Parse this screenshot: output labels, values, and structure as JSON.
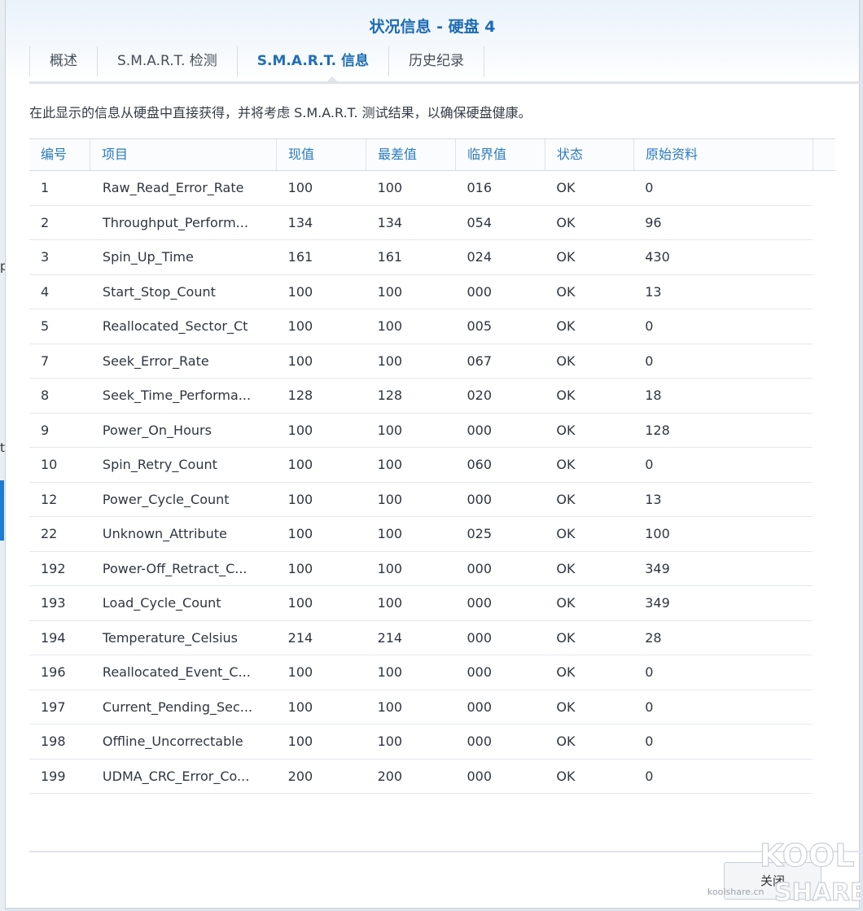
{
  "background": {
    "frag1": "p",
    "frag2": "t"
  },
  "dialog": {
    "title": "状况信息 - 硬盘 4",
    "tabs": [
      {
        "label": "概述"
      },
      {
        "label": "S.M.A.R.T. 检测"
      },
      {
        "label": "S.M.A.R.T. 信息"
      },
      {
        "label": "历史纪录"
      }
    ],
    "active_tab": "S.M.A.R.T. 信息",
    "description": "在此显示的信息从硬盘中直接获得，并将考虑 S.M.A.R.T. 测试结果，以确保硬盘健康。",
    "columns": [
      "编号",
      "项目",
      "现值",
      "最差值",
      "临界值",
      "状态",
      "原始资料"
    ],
    "rows": [
      [
        "1",
        "Raw_Read_Error_Rate",
        "100",
        "100",
        "016",
        "OK",
        "0"
      ],
      [
        "2",
        "Throughput_Perform...",
        "134",
        "134",
        "054",
        "OK",
        "96"
      ],
      [
        "3",
        "Spin_Up_Time",
        "161",
        "161",
        "024",
        "OK",
        "430"
      ],
      [
        "4",
        "Start_Stop_Count",
        "100",
        "100",
        "000",
        "OK",
        "13"
      ],
      [
        "5",
        "Reallocated_Sector_Ct",
        "100",
        "100",
        "005",
        "OK",
        "0"
      ],
      [
        "7",
        "Seek_Error_Rate",
        "100",
        "100",
        "067",
        "OK",
        "0"
      ],
      [
        "8",
        "Seek_Time_Performa...",
        "128",
        "128",
        "020",
        "OK",
        "18"
      ],
      [
        "9",
        "Power_On_Hours",
        "100",
        "100",
        "000",
        "OK",
        "128"
      ],
      [
        "10",
        "Spin_Retry_Count",
        "100",
        "100",
        "060",
        "OK",
        "0"
      ],
      [
        "12",
        "Power_Cycle_Count",
        "100",
        "100",
        "000",
        "OK",
        "13"
      ],
      [
        "22",
        "Unknown_Attribute",
        "100",
        "100",
        "025",
        "OK",
        "100"
      ],
      [
        "192",
        "Power-Off_Retract_C...",
        "100",
        "100",
        "000",
        "OK",
        "349"
      ],
      [
        "193",
        "Load_Cycle_Count",
        "100",
        "100",
        "000",
        "OK",
        "349"
      ],
      [
        "194",
        "Temperature_Celsius",
        "214",
        "214",
        "000",
        "OK",
        "28"
      ],
      [
        "196",
        "Reallocated_Event_C...",
        "100",
        "100",
        "000",
        "OK",
        "0"
      ],
      [
        "197",
        "Current_Pending_Sec...",
        "100",
        "100",
        "000",
        "OK",
        "0"
      ],
      [
        "198",
        "Offline_Uncorrectable",
        "100",
        "100",
        "000",
        "OK",
        "0"
      ],
      [
        "199",
        "UDMA_CRC_Error_Co...",
        "200",
        "200",
        "000",
        "OK",
        "0"
      ]
    ],
    "close_label": "关闭"
  },
  "watermark": {
    "line1": "KOOL",
    "line2": "SHARE",
    "site": "koolshare.cn"
  },
  "colors": {
    "accent": "#1d6bb5",
    "header_text": "#2a7ac0"
  }
}
